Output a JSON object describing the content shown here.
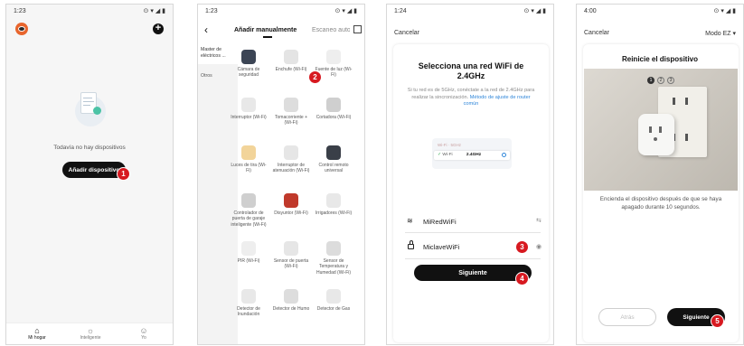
{
  "p1": {
    "time": "1:23",
    "icons": "⊙ ▾ ◢ ▮",
    "empty": "Todavía no hay dispositivos",
    "add_btn": "Añadir dispositivo",
    "badge": "1",
    "nav": [
      {
        "label": "Mi hogar"
      },
      {
        "label": "Inteligente"
      },
      {
        "label": "Yo"
      }
    ]
  },
  "p2": {
    "time": "1:23",
    "icons": "⊙ ▾ ◢ ▮",
    "tab1": "Añadir manualmente",
    "tab2": "Escaneo auto",
    "sidebar": [
      {
        "label": "Master de eléctricos ..."
      },
      {
        "label": "Otros"
      }
    ],
    "badge": "2",
    "devices": [
      {
        "label": "Cámara de seguridad",
        "color": "#3c4555"
      },
      {
        "label": "Enchufe (Wi-Fi)",
        "color": "#e4e4e4"
      },
      {
        "label": "Fuente de luz (Wi-Fi)",
        "color": "#eeeeee"
      },
      {
        "label": "Interruptor (Wi-Fi)",
        "color": "#e8e8e8"
      },
      {
        "label": "Tomacorriente + (Wi-Fi)",
        "color": "#dddddd"
      },
      {
        "label": "Cortadora (Wi-Fi)",
        "color": "#cfcfcf"
      },
      {
        "label": "Luces de tira (Wi-Fi)",
        "color": "#f2d49a"
      },
      {
        "label": "Interruptor de atenuación (Wi-Fi)",
        "color": "#e6e6e6"
      },
      {
        "label": "Control remoto universal",
        "color": "#3a3f48"
      },
      {
        "label": "Controlador de puerta de garaje inteligente (Wi-Fi)",
        "color": "#cfcfcf"
      },
      {
        "label": "Disyuntor (Wi-Fi)",
        "color": "#c0392b"
      },
      {
        "label": "Irrigadores (Wi-Fi)",
        "color": "#e8e8e8"
      },
      {
        "label": "PIR (Wi-Fi)",
        "color": "#eeeeee"
      },
      {
        "label": "Sensor de puerta (Wi-Fi)",
        "color": "#e6e6e6"
      },
      {
        "label": "Sensor de Temperatura y Humedad (Wi-Fi)",
        "color": "#dcdcdc"
      },
      {
        "label": "Detector de Inundación",
        "color": "#e8e8e8"
      },
      {
        "label": "Detector de Humo",
        "color": "#dddddd"
      },
      {
        "label": "Detector de Gas",
        "color": "#e8e8e8"
      }
    ]
  },
  "p3": {
    "time": "1:24",
    "icons": "⊙ ▾ ◢ ▮",
    "cancel": "Cancelar",
    "title": "Selecciona una red WiFi de 2.4GHz",
    "desc": "Si tu red es de 5GHz, conéctate a la red de 2.4GHz para realizar la sincronización.",
    "link": "Método de ajuste de router común",
    "illus_5g": "Wi-Fi · 5GHz",
    "illus_wifi": "Wi-Fi",
    "illus_24": "2.4GHz",
    "ssid": "MiRedWiFi",
    "password": "MiclaveWiFi",
    "next": "Siguiente",
    "badge3": "3",
    "badge4": "4"
  },
  "p4": {
    "time": "4:00",
    "icons": "⊙ ▾ ◢ ▮",
    "cancel": "Cancelar",
    "mode": "Modo EZ",
    "title": "Reinicie el dispositivo",
    "steps": [
      "1",
      "2",
      "3"
    ],
    "desc": "Encienda el dispositivo después de que se haya apagado durante 10 segundos.",
    "back": "Atrás",
    "next": "Siguiente",
    "badge": "5"
  },
  "colors": {
    "accent": "#d71920",
    "link": "#2f86d9",
    "dark": "#111111"
  }
}
